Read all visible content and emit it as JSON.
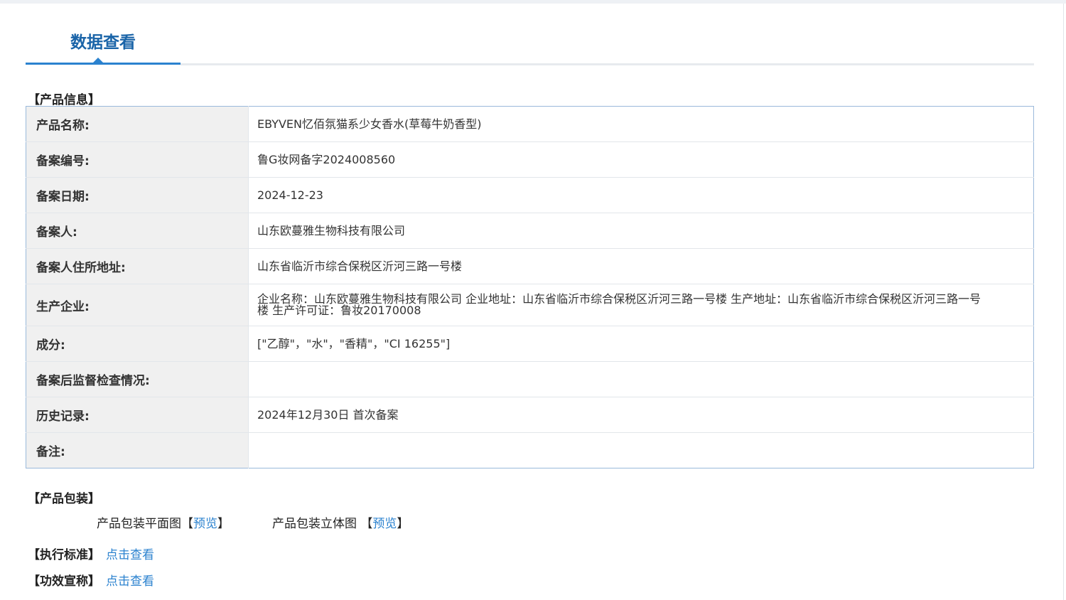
{
  "header": {
    "active_tab": "数据查看"
  },
  "sections": {
    "product_info_title": "【产品信息】",
    "packaging_title": "【产品包装】"
  },
  "info_rows": [
    {
      "label": "产品名称:",
      "value": "EBYVEN忆佰氛猫系少女香水(草莓牛奶香型)"
    },
    {
      "label": "备案编号:",
      "value": "鲁G妆网备字2024008560"
    },
    {
      "label": "备案日期:",
      "value": "2024-12-23"
    },
    {
      "label": "备案人:",
      "value": "山东欧蔓雅生物科技有限公司"
    },
    {
      "label": "备案人住所地址:",
      "value": "山东省临沂市综合保税区沂河三路一号楼"
    },
    {
      "label": "生产企业:",
      "value": "企业名称：山东欧蔓雅生物科技有限公司 企业地址：山东省临沂市综合保税区沂河三路一号楼 生产地址：山东省临沂市综合保税区沂河三路一号楼 生产许可证：鲁妆20170008"
    },
    {
      "label": "成分:",
      "value": "[\"乙醇\"，\"水\"，\"香精\"，\"CI 16255\"]"
    },
    {
      "label": "备案后监督检查情况:",
      "value": ""
    },
    {
      "label": "历史记录:",
      "value": "2024年12月30日 首次备案"
    },
    {
      "label": "备注:",
      "value": ""
    }
  ],
  "packaging": {
    "flat_label": "产品包装平面图",
    "flat_bracket_open": "【",
    "flat_link": "预览",
    "flat_bracket_close": "】",
    "3d_label": "产品包装立体图",
    "3d_bracket_open": " 【",
    "3d_link": "预览",
    "3d_bracket_close": "】"
  },
  "standards": {
    "exec_label": "【执行标准】",
    "exec_link": "点击查看",
    "efficacy_label": "【功效宣称】",
    "efficacy_link": "点击查看"
  },
  "colors": {
    "accent": "#2b82cf",
    "tab_text": "#1a64a8",
    "table_border": "#9ab9db",
    "key_bg": "#f0f0f0"
  }
}
